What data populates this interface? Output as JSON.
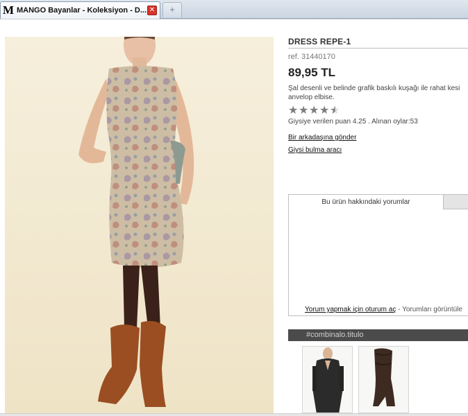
{
  "browser": {
    "tab_title": "MANGO Bayanlar - Koleksiyon - D...",
    "close_glyph": "✕",
    "new_tab_glyph": "+"
  },
  "product": {
    "name": "DRESS REPE-1",
    "ref": "ref. 31440170",
    "price": "89,95 TL",
    "description_line1": "Şal desenli ve belinde grafik baskılı kuşağı ile rahat kesi",
    "description_line2": "anvelop elbise.",
    "rating": 4.25,
    "rating_text": "Giysiye verilen puan 4.25 . Alınan oylar:53",
    "link_send_friend": "Bir arkadaşına gönder",
    "link_size_tool": "Giysi bulma aracı"
  },
  "comments": {
    "tab_label": "Bu ürün hakkındaki yorumlar",
    "login_link": "Yorum yapmak için oturum aç",
    "footer_rest": " - Yorumları görüntüle"
  },
  "combination": {
    "title": "#combinalo.titulo"
  },
  "icons": {
    "favicon": "M",
    "star": "★"
  },
  "colors": {
    "photo_bg": "#f3ead4",
    "dress": "#c9b59b",
    "boots": "#9a4e22",
    "stockings": "#3a2119",
    "combo_bar": "#4b4b4b"
  }
}
